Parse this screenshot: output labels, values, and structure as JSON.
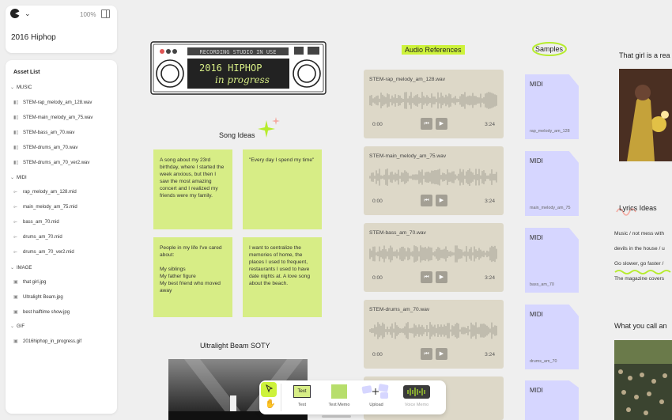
{
  "header": {
    "zoom": "100%",
    "project_title": "2016 Hiphop"
  },
  "assets": {
    "title": "Asset List",
    "groups": [
      {
        "name": "MUSIC",
        "items": [
          "STEM-rap_melody_am_128.wav",
          "STEM-main_melody_am_75.wav",
          "STEM-bass_am_70.wav",
          "STEM-drums_am_70.wav",
          "STEM-drums_am_70_ver2.wav"
        ]
      },
      {
        "name": "MIDI",
        "items": [
          "rap_melody_am_128.mid",
          "main_melody_am_75.mid",
          "bass_am_70.mid",
          "drums_am_70.mid",
          "drums_am_70_ver2.mid"
        ]
      },
      {
        "name": "IMAGE",
        "items": [
          "that girl.jpg",
          "Ultralight Beam.jpg",
          "best halftime show.jpg"
        ]
      },
      {
        "name": "GIF",
        "items": [
          "2016hiphop_in_progress.gif"
        ]
      }
    ]
  },
  "boombox": {
    "banner": "RECORDING STUDIO IN USE",
    "line1": "2016 HIPHOP",
    "line2": "in progress"
  },
  "song_ideas": {
    "title": "Song Ideas",
    "notes": [
      "A song about my 23rd birthday, where I started the week anxious, but then I saw the most amazing concert and I realized my friends were my family.",
      "\"Every day I spend my time\"",
      "People in my life I've cared about:\n\nMy siblings\nMy father figure\nMy best friend who moved away",
      "I want to centralize the memories of home, the places I used to frequent, restaurants I used to have date nights at. A love song about the beach."
    ]
  },
  "ultralight": {
    "title": "Ultralight Beam SOTY"
  },
  "audio_refs": {
    "title": "Audio References",
    "tracks": [
      {
        "name": "STEM-rap_melody_am_128.wav",
        "start": "0:00",
        "end": "3:24"
      },
      {
        "name": "STEM-main_melody_am_75.wav",
        "start": "0:00",
        "end": "3:24"
      },
      {
        "name": "STEM-bass_am_70.wav",
        "start": "0:00",
        "end": "3:24"
      },
      {
        "name": "STEM-drums_am_70.wav",
        "start": "0:00",
        "end": "3:24"
      }
    ]
  },
  "samples": {
    "title": "Samples",
    "files": [
      {
        "type": "MIDI",
        "name": "rap_melody_am_128"
      },
      {
        "type": "MIDI",
        "name": "main_melody_am_75"
      },
      {
        "type": "MIDI",
        "name": "bass_am_70"
      },
      {
        "type": "MIDI",
        "name": "drums_am_70"
      },
      {
        "type": "MIDI",
        "name": ""
      }
    ]
  },
  "right": {
    "girl_title": "That girl is a rea",
    "lyrics_title": "Lyrics Ideas",
    "lyrics": [
      "Music / not mess with",
      "devils in the house / u",
      "Go slower, go faster /",
      "The magazine covers"
    ],
    "call_title": "What you call an"
  },
  "toolbar": {
    "tools": [
      {
        "label": "Text"
      },
      {
        "label": "Text Memo"
      },
      {
        "label": "Upload"
      },
      {
        "label": "Voice Memo"
      }
    ]
  },
  "colors": {
    "accent": "#cdf23b",
    "sticky": "#d7ed86",
    "audio": "#ddd8c8",
    "midi": "#d6d6ff"
  }
}
